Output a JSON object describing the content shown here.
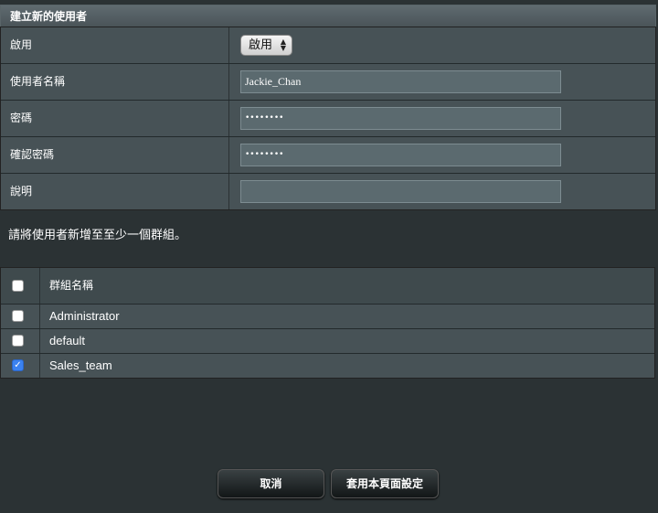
{
  "form": {
    "header": "建立新的使用者",
    "rows": [
      {
        "label": "啟用",
        "value": "啟用"
      },
      {
        "label": "使用者名稱",
        "value": "Jackie_Chan"
      },
      {
        "label": "密碼",
        "value": "••••••••"
      },
      {
        "label": "確認密碼",
        "value": "••••••••"
      },
      {
        "label": "說明",
        "value": ""
      }
    ]
  },
  "hint": "請將使用者新增至至少一個群組。",
  "groups": {
    "header_label": "群組名稱",
    "select_all_checked": false,
    "items": [
      {
        "name": "Administrator",
        "checked": false
      },
      {
        "name": "default",
        "checked": false
      },
      {
        "name": "Sales_team",
        "checked": true
      }
    ]
  },
  "buttons": {
    "cancel": "取消",
    "apply": "套用本頁面設定"
  },
  "icons": {
    "select_arrows": "updown-arrows-icon",
    "checkmark": "checkmark-icon"
  },
  "colors": {
    "background": "#2b3234",
    "row": "#475256",
    "checkbox_checked": "#3b82f0"
  }
}
